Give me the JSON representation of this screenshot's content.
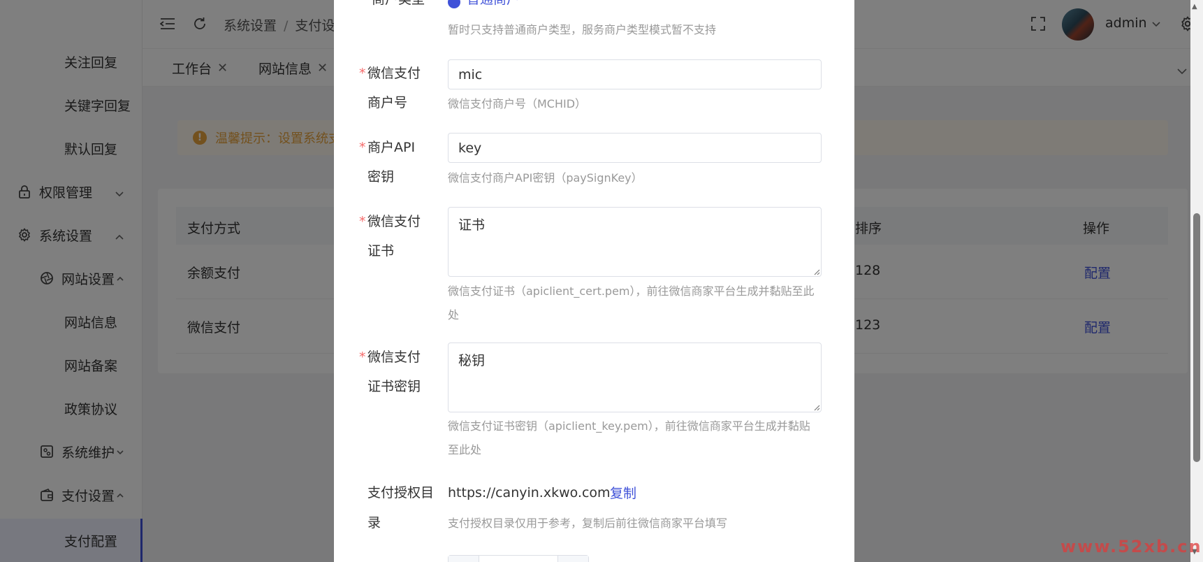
{
  "sidebar": {
    "items": [
      {
        "label": "关注回复"
      },
      {
        "label": "关键字回复"
      },
      {
        "label": "默认回复"
      },
      {
        "label": "权限管理"
      },
      {
        "label": "系统设置"
      },
      {
        "label": "网站设置"
      },
      {
        "label": "网站信息"
      },
      {
        "label": "网站备案"
      },
      {
        "label": "政策协议"
      },
      {
        "label": "系统维护"
      },
      {
        "label": "支付设置"
      },
      {
        "label": "支付配置"
      }
    ]
  },
  "header": {
    "breadcrumb": [
      "系统设置",
      "支付设"
    ],
    "separator": "/",
    "user_name": "admin"
  },
  "tabs": [
    {
      "label": "工作台"
    },
    {
      "label": "网站信息"
    }
  ],
  "notice": {
    "text": "温馨提示：设置系统支"
  },
  "table": {
    "columns": [
      "支付方式",
      "排序",
      "操作"
    ],
    "rows": [
      {
        "method": "余额支付",
        "sort": "128",
        "action": "配置"
      },
      {
        "method": "微信支付",
        "sort": "123",
        "action": "配置"
      }
    ]
  },
  "dialog": {
    "merchant_type": {
      "label": "商户类型",
      "value": "普通商户",
      "help": "暂时只支持普通商户类型，服务商户类型模式暂不支持"
    },
    "mchid": {
      "label_line1": "微信支付",
      "label_line2": "商户号",
      "value": "mic",
      "help": "微信支付商户号（MCHID）"
    },
    "api_key": {
      "label_line1": "商户API",
      "label_line2": "密钥",
      "value": "key",
      "help": "微信支付商户API密钥（paySignKey）"
    },
    "cert": {
      "label_line1": "微信支付",
      "label_line2": "证书",
      "value": "证书",
      "help_line1": "微信支付证书（apiclient_cert.pem），前往微信商家平台生成并黏贴至此",
      "help_line2": "处"
    },
    "cert_key": {
      "label_line1": "微信支付",
      "label_line2": "证书密钥",
      "value": "秘钥",
      "help_line1": "微信支付证书密钥（apiclient_key.pem），前往微信商家平台生成并黏贴",
      "help_line2": "至此处"
    },
    "auth_dir": {
      "label_line1": "支付授权目",
      "label_line2": "录",
      "value": "https://canyin.xkwo.com",
      "copy_label": "复制",
      "help": "支付授权目录仅用于参考，复制后前往微信商家平台填写"
    }
  },
  "watermark": "www.52xb.cn",
  "colors": {
    "primary": "#3f51d8",
    "required": "#f56c6c",
    "warning": "#e6a23c"
  }
}
